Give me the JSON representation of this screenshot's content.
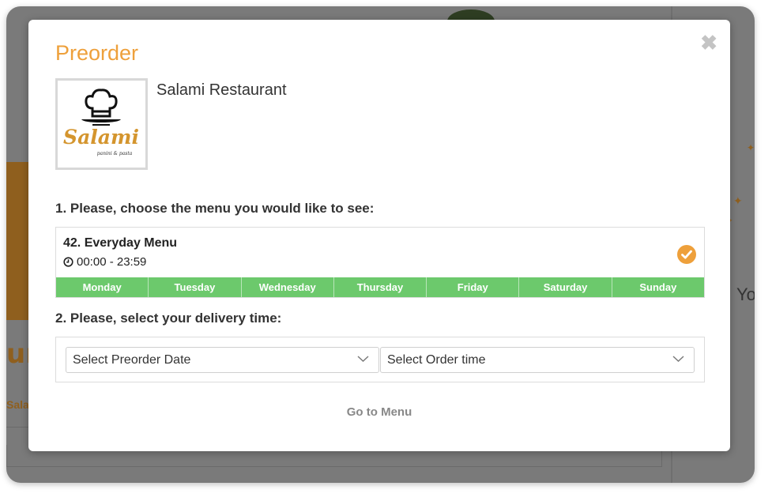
{
  "background": {
    "partial_word": "ura",
    "partial_tab": "Salad",
    "partial_text": "Yo"
  },
  "modal": {
    "title": "Preorder",
    "close_symbol": "✖",
    "restaurant": {
      "name": "Salami Restaurant",
      "logo_text": "Salami",
      "logo_subtext": "panini & pasta"
    },
    "step1_label": "1. Please, choose the menu you would like to see:",
    "menu": {
      "name": "42. Everyday Menu",
      "hours": "00:00 - 23:59",
      "days": [
        "Monday",
        "Tuesday",
        "Wednesday",
        "Thursday",
        "Friday",
        "Saturday",
        "Sunday"
      ],
      "selected": true
    },
    "step2_label": "2. Please, select your delivery time:",
    "date_select": {
      "value": "Select Preorder Date"
    },
    "time_select": {
      "value": "Select Order time"
    },
    "go_to_menu": "Go to Menu"
  },
  "colors": {
    "accent": "#eea03b",
    "days_bar": "#6cc96c",
    "overlay": "#7a7a7a"
  }
}
